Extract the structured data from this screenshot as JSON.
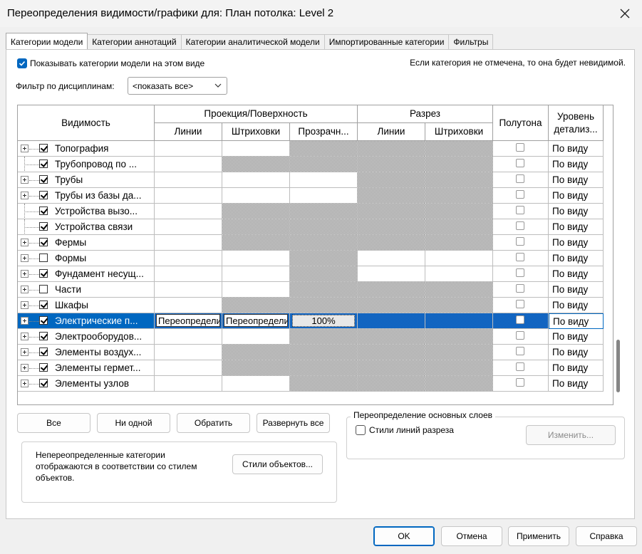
{
  "window": {
    "title": "Переопределения видимости/графики для: План потолка: Level 2"
  },
  "tabs": [
    {
      "label": "Категории модели",
      "active": true
    },
    {
      "label": "Категории аннотаций"
    },
    {
      "label": "Категории аналитической модели"
    },
    {
      "label": "Импортированные категории"
    },
    {
      "label": "Фильтры"
    }
  ],
  "options": {
    "show_model_label": "Показывать категории модели на этом виде",
    "hint": "Если категория не отмечена, то она будет невидимой.",
    "discipline_filter_label": "Фильтр по дисциплинам:",
    "discipline_filter_value": "<показать все>"
  },
  "table": {
    "headers": {
      "visibility": "Видимость",
      "projection": "Проекция/Поверхность",
      "proj_lines": "Линии",
      "proj_patterns": "Штриховки",
      "proj_transparency": "Прозрачн...",
      "cut": "Разрез",
      "cut_lines": "Линии",
      "cut_patterns": "Штриховки",
      "halftone": "Полутона",
      "detail_level": "Уровень детализ..."
    },
    "rows": [
      {
        "name": "Топография",
        "level": "По виду"
      },
      {
        "name": "Трубопровод по ...",
        "level": "По виду"
      },
      {
        "name": "Трубы",
        "level": "По виду"
      },
      {
        "name": "Трубы из базы да...",
        "level": "По виду"
      },
      {
        "name": "Устройства вызо...",
        "level": "По виду"
      },
      {
        "name": "Устройства связи",
        "level": "По виду"
      },
      {
        "name": "Фермы",
        "level": "По виду"
      },
      {
        "name": "Формы",
        "level": "По виду"
      },
      {
        "name": "Фундамент несущ...",
        "level": "По виду"
      },
      {
        "name": "Части",
        "level": "По виду"
      },
      {
        "name": "Шкафы",
        "level": "По виду"
      },
      {
        "name": "Электрические п...",
        "level": "По виду",
        "proj_lines": "Переопределить...",
        "proj_patterns": "Переопределить...",
        "transparency": "100%"
      },
      {
        "name": "Электрооборудов...",
        "level": "По виду"
      },
      {
        "name": "Элементы воздух...",
        "level": "По виду"
      },
      {
        "name": "Элементы гермет...",
        "level": "По виду"
      },
      {
        "name": "Элементы узлов",
        "level": "По виду"
      }
    ]
  },
  "buttons": {
    "all": "Все",
    "none": "Ни одной",
    "invert": "Обратить",
    "expand_all": "Развернуть все",
    "object_styles": "Стили объектов...",
    "edit": "Изменить...",
    "ok": "OK",
    "cancel": "Отмена",
    "apply": "Применить",
    "help": "Справка"
  },
  "layers_group": {
    "title": "Переопределение основных слоев",
    "cut_line_styles": "Стили линий разреза"
  },
  "note": "Непереопределенные категории отображаются в соответствии со стилем объектов."
}
